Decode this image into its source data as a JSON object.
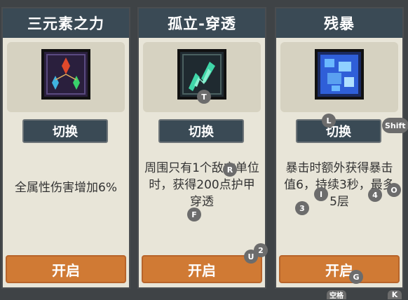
{
  "cards": [
    {
      "title": "三元素之力",
      "switch_label": "切换",
      "description": "全属性伤害增加6%",
      "open_label": "开启",
      "icon": "triple-element-crystals-icon"
    },
    {
      "title": "孤立-穿透",
      "switch_label": "切换",
      "description": "周围只有1个敌方单位时，获得200点护甲穿透",
      "open_label": "开启",
      "icon": "green-spiral-penetration-icon"
    },
    {
      "title": "残暴",
      "switch_label": "切换",
      "description": "暴击时额外获得暴击值6，持续3秒，最多5层",
      "open_label": "开启",
      "icon": "blue-ice-brutal-icon"
    }
  ],
  "key_hints": [
    "T",
    "R",
    "F",
    "U",
    "2",
    "L",
    "Shift",
    "O",
    "I",
    "4",
    "3",
    "G",
    "K",
    "空格"
  ],
  "colors": {
    "title_bar": "#3a4a55",
    "card_bg": "#e8e5d8",
    "open_button": "#d07a34",
    "hint_badge": "#6c6c6c"
  }
}
